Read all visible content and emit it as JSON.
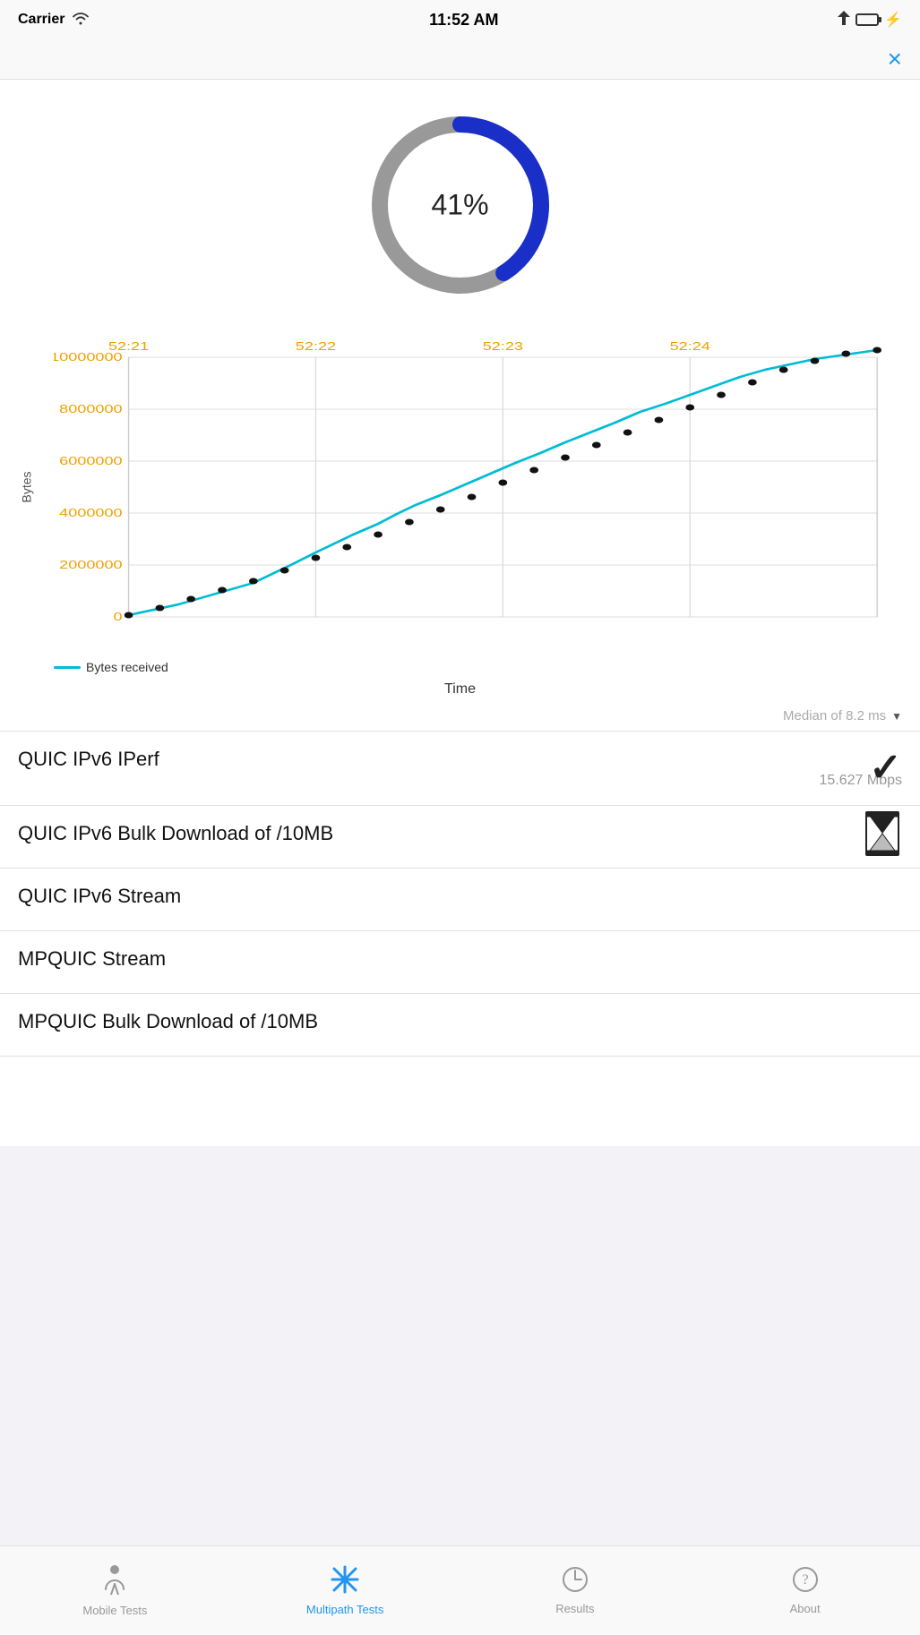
{
  "statusBar": {
    "carrier": "Carrier",
    "time": "11:52 AM",
    "signal": "wifi"
  },
  "closeButton": "×",
  "progressCircle": {
    "percent": 41,
    "label": "41%",
    "trackColor": "#888",
    "progressColor": "#1e40af"
  },
  "chart": {
    "yAxisLabel": "Bytes",
    "xAxisLabel": "Time",
    "yLabels": [
      "0",
      "2000000",
      "4000000",
      "6000000",
      "8000000",
      "10000000"
    ],
    "xLabels": [
      "52:21",
      "52:22",
      "52:23",
      "52:24"
    ],
    "legendLabel": "Bytes received",
    "medianLabel": "Median of 8.2 ms"
  },
  "tests": [
    {
      "name": "QUIC IPv6 IPerf",
      "speed": "15.627 Mbps",
      "status": "done",
      "icon": "checkmark"
    },
    {
      "name": "QUIC IPv6 Bulk Download of /10MB",
      "speed": "",
      "status": "running",
      "icon": "hourglass"
    },
    {
      "name": "QUIC IPv6 Stream",
      "speed": "",
      "status": "pending",
      "icon": ""
    },
    {
      "name": "MPQUIC Stream",
      "speed": "",
      "status": "pending",
      "icon": ""
    },
    {
      "name": "MPQUIC Bulk Download of /10MB",
      "speed": "",
      "status": "pending",
      "icon": ""
    }
  ],
  "tabs": [
    {
      "label": "Mobile Tests",
      "icon": "🚶",
      "active": false
    },
    {
      "label": "Multipath Tests",
      "icon": "✛",
      "active": true
    },
    {
      "label": "Results",
      "icon": "🕐",
      "active": false
    },
    {
      "label": "About",
      "icon": "?",
      "active": false
    }
  ]
}
